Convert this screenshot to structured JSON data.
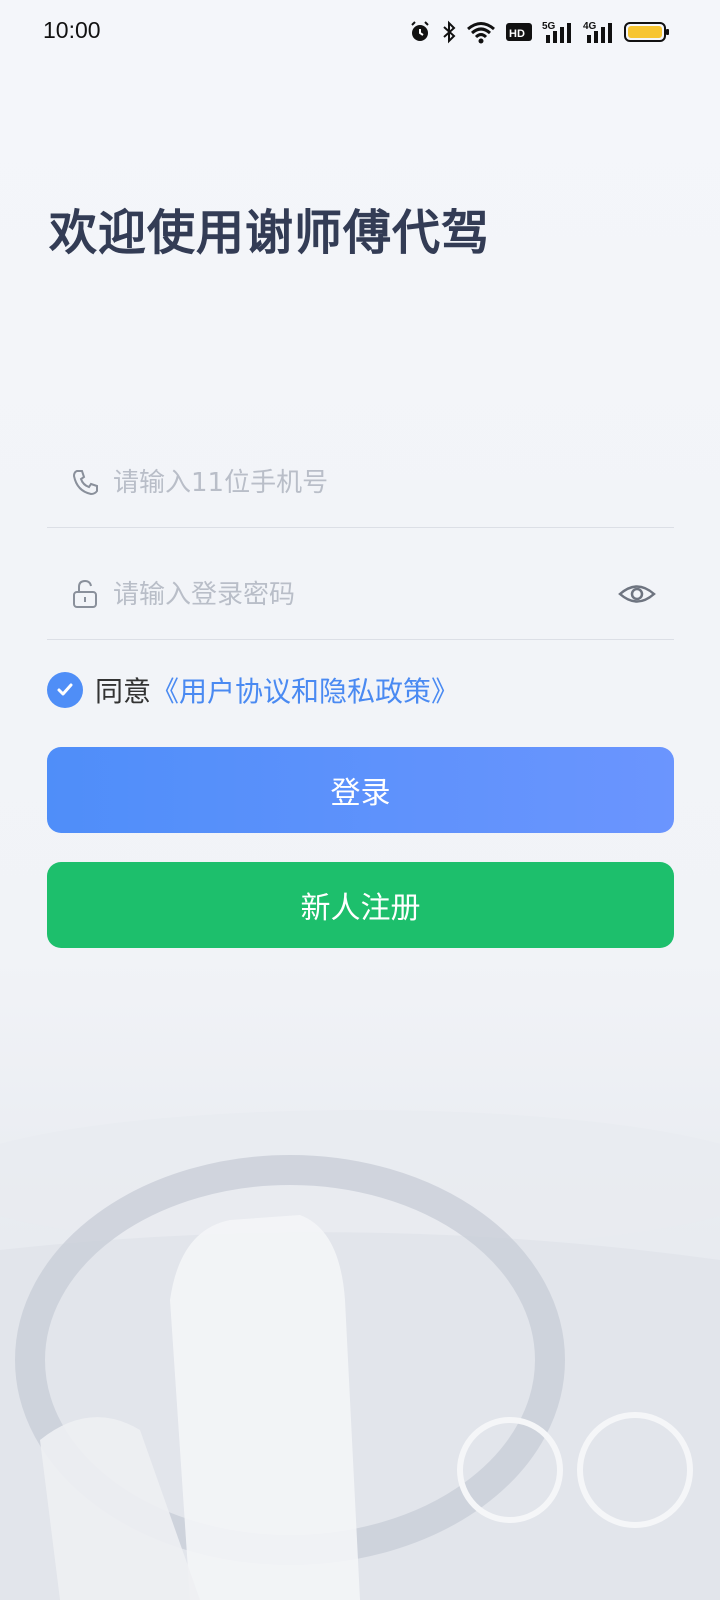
{
  "status_bar": {
    "time": "10:00",
    "icons": [
      "alarm-icon",
      "bluetooth-icon",
      "wifi-icon",
      "hd-icon",
      "5g-signal-icon",
      "4g-signal-icon",
      "battery-icon"
    ],
    "battery_color": "#f7c531"
  },
  "title": "欢迎使用谢师傅代驾",
  "phone_field": {
    "placeholder": "请输入11位手机号",
    "value": "",
    "icon": "phone-icon"
  },
  "password_field": {
    "placeholder": "请输入登录密码",
    "value": "",
    "icon": "unlock-icon",
    "toggle_icon": "eye-icon"
  },
  "agreement": {
    "checked": true,
    "prefix": "同意",
    "link": "《用户协议和隐私政策》"
  },
  "buttons": {
    "login": "登录",
    "register": "新人注册"
  },
  "colors": {
    "accent": "#4f8ef7",
    "login_gradient_start": "#4f8ef9",
    "login_gradient_end": "#6b95fe",
    "register": "#1dbf6c",
    "link": "#4a8af2",
    "title": "#333c55"
  }
}
